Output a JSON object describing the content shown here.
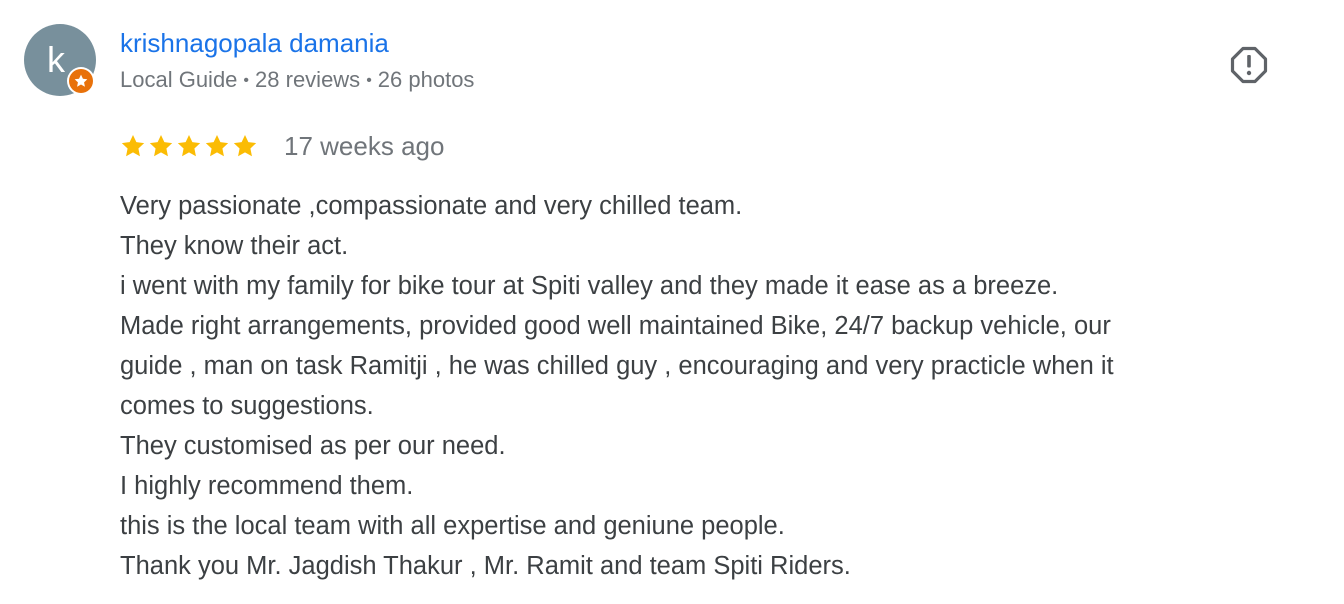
{
  "author": {
    "initial": "k",
    "name": "krishnagopala damania",
    "level": "Local Guide",
    "reviews": "28 reviews",
    "photos": "26 photos",
    "separator": "•"
  },
  "review": {
    "rating": 5,
    "rating_max": 5,
    "date": "17 weeks ago",
    "lines": [
      "Very passionate ,compassionate and very chilled team.",
      "They know their act.",
      "i went with my family for bike tour at Spiti valley and they made it ease as a breeze.",
      "Made right arrangements, provided good well maintained Bike, 24/7 backup vehicle, our",
      "guide , man on task Ramitji , he was chilled guy , encouraging and very practicle when it",
      "comes to suggestions.",
      "They customised as per our need.",
      "I highly recommend them.",
      "this is the local team with all expertise and geniune people.",
      "Thank you Mr. Jagdish Thakur , Mr. Ramit and team Spiti Riders."
    ]
  },
  "icons": {
    "badge": "local-guide-star-icon",
    "report": "report-flag-icon",
    "rating_star": "star-icon"
  },
  "colors": {
    "author_link": "#1a73e8",
    "avatar_bg": "#78909c",
    "badge": "#e8710a",
    "star": "#fbbc04",
    "meta_text": "#70757a",
    "body_text": "#3c4043",
    "report_icon": "#5f6368"
  }
}
